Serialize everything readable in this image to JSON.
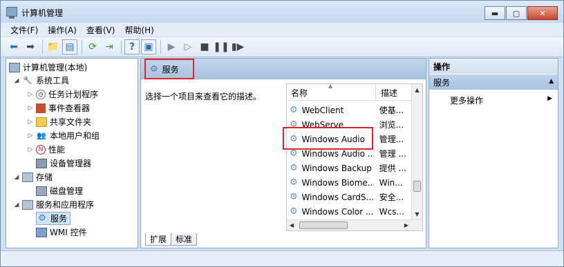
{
  "window": {
    "title": "计算机管理"
  },
  "menu": [
    "文件(F)",
    "操作(A)",
    "查看(V)",
    "帮助(H)"
  ],
  "tree": {
    "root": "计算机管理(本地)",
    "system_tools": "系统工具",
    "task_scheduler": "任务计划程序",
    "event_viewer": "事件查看器",
    "shared_folders": "共享文件夹",
    "local_users": "本地用户和组",
    "performance": "性能",
    "device_manager": "设备管理器",
    "storage": "存储",
    "disk_management": "磁盘管理",
    "services_apps": "服务和应用程序",
    "services": "服务",
    "wmi": "WMI 控件"
  },
  "center": {
    "title": "服务",
    "description": "选择一个项目来查看它的描述。",
    "columns": {
      "name": "名称",
      "desc": "描述"
    },
    "rows": [
      {
        "name": "WebClient",
        "desc": "使基..."
      },
      {
        "name": "WebServe",
        "desc": "浏览..."
      },
      {
        "name": "Windows Audio",
        "desc": "管理..."
      },
      {
        "name": "Windows Audio ...",
        "desc": "管理 ..."
      },
      {
        "name": "Windows Backup",
        "desc": "提供 ..."
      },
      {
        "name": "Windows Biome...",
        "desc": "Win..."
      },
      {
        "name": "Windows CardS...",
        "desc": "安全..."
      },
      {
        "name": "Windows Color ...",
        "desc": "Wcs..."
      }
    ],
    "tabs": [
      "扩展",
      "标准"
    ]
  },
  "actions": {
    "header": "操作",
    "section": "服务",
    "more": "更多操作"
  }
}
